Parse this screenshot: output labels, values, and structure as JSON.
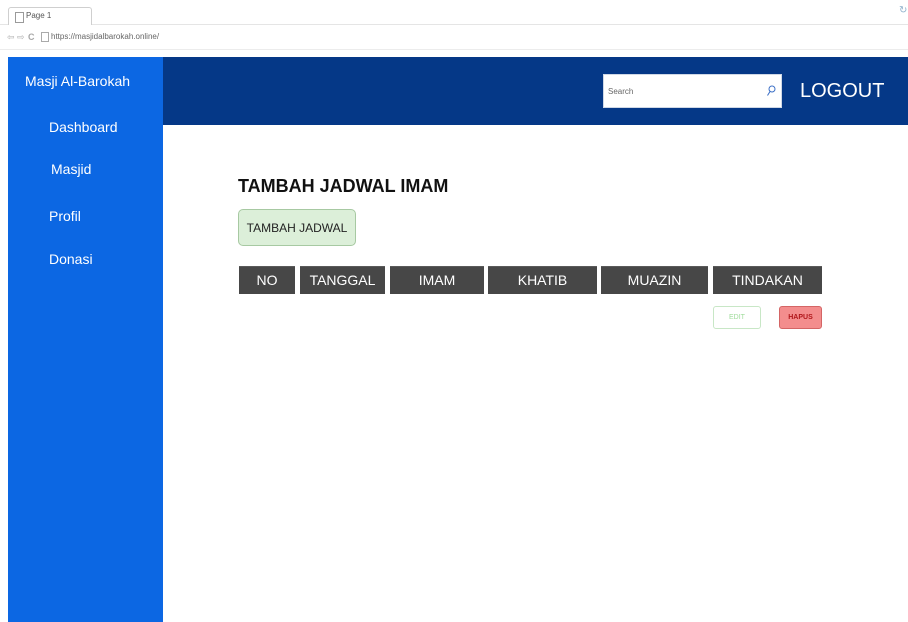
{
  "browser": {
    "tab_title": "Page 1",
    "url": "https://masjidalbarokah.online/"
  },
  "sidebar": {
    "brand": "Masji Al-Barokah",
    "items": [
      {
        "label": "Dashboard"
      },
      {
        "label": "Masjid"
      },
      {
        "label": "Profil"
      },
      {
        "label": "Donasi"
      }
    ]
  },
  "header": {
    "search_placeholder": "Search",
    "logout_label": "LOGOUT"
  },
  "main": {
    "title": "TAMBAH JADWAL IMAM",
    "add_button_label": "TAMBAH JADWAL",
    "table": {
      "columns": [
        "NO",
        "TANGGAL",
        "IMAM",
        "KHATIB",
        "MUAZIN",
        "TINDAKAN"
      ]
    },
    "actions": {
      "edit_label": "EDIT",
      "delete_label": "HAPUS"
    }
  },
  "colors": {
    "sidebar_bg": "#0c67e3",
    "header_bg": "#053887",
    "table_header_bg": "#474747",
    "add_button_bg": "#dcefd9",
    "delete_button_bg": "#f38d8d"
  }
}
